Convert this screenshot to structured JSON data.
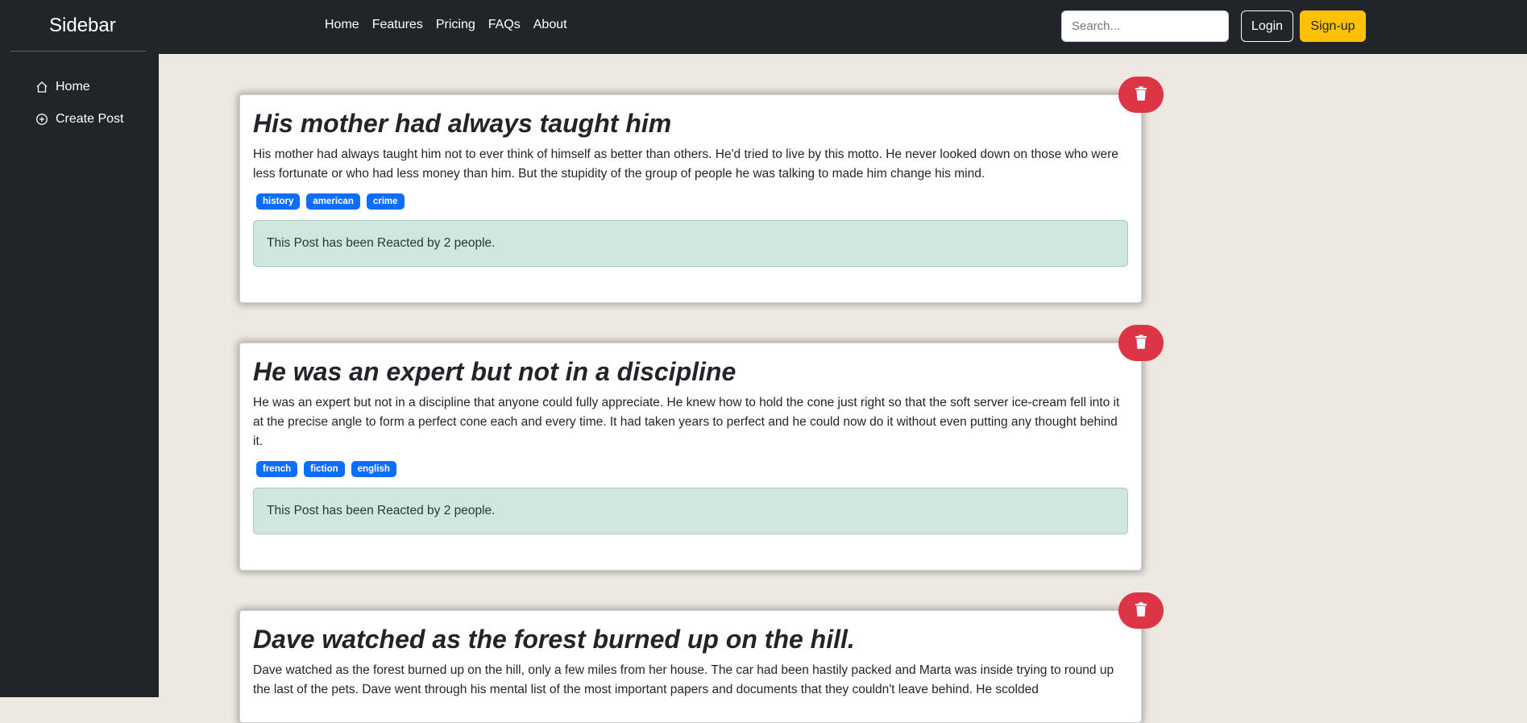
{
  "sidebar": {
    "brand": "Sidebar",
    "items": [
      {
        "label": "Home",
        "icon": "house-icon"
      },
      {
        "label": "Create Post",
        "icon": "plus-circle-icon"
      }
    ]
  },
  "navbar": {
    "links": [
      "Home",
      "Features",
      "Pricing",
      "FAQs",
      "About"
    ],
    "search_placeholder": "Search...",
    "login_label": "Login",
    "signup_label": "Sign-up"
  },
  "colors": {
    "dark": "#212529",
    "page_bg": "#ede8e0",
    "danger": "#dc3545",
    "warning": "#ffc107",
    "primary": "#0d6efd",
    "success_bg": "#d1e7dd"
  },
  "posts": [
    {
      "title": "His mother had always taught him",
      "body": "His mother had always taught him not to ever think of himself as better than others. He'd tried to live by this motto. He never looked down on those who were less fortunate or who had less money than him. But the stupidity of the group of people he was talking to made him change his mind.",
      "tags": [
        "history",
        "american",
        "crime"
      ],
      "reaction": "This Post has been Reacted by 2 people."
    },
    {
      "title": "He was an expert but not in a discipline",
      "body": "He was an expert but not in a discipline that anyone could fully appreciate. He knew how to hold the cone just right so that the soft server ice-cream fell into it at the precise angle to form a perfect cone each and every time. It had taken years to perfect and he could now do it without even putting any thought behind it.",
      "tags": [
        "french",
        "fiction",
        "english"
      ],
      "reaction": "This Post has been Reacted by 2 people."
    },
    {
      "title": "Dave watched as the forest burned up on the hill.",
      "body": "Dave watched as the forest burned up on the hill, only a few miles from her house. The car had been hastily packed and Marta was inside trying to round up the last of the pets. Dave went through his mental list of the most important papers and documents that they couldn't leave behind. He scolded"
    }
  ]
}
